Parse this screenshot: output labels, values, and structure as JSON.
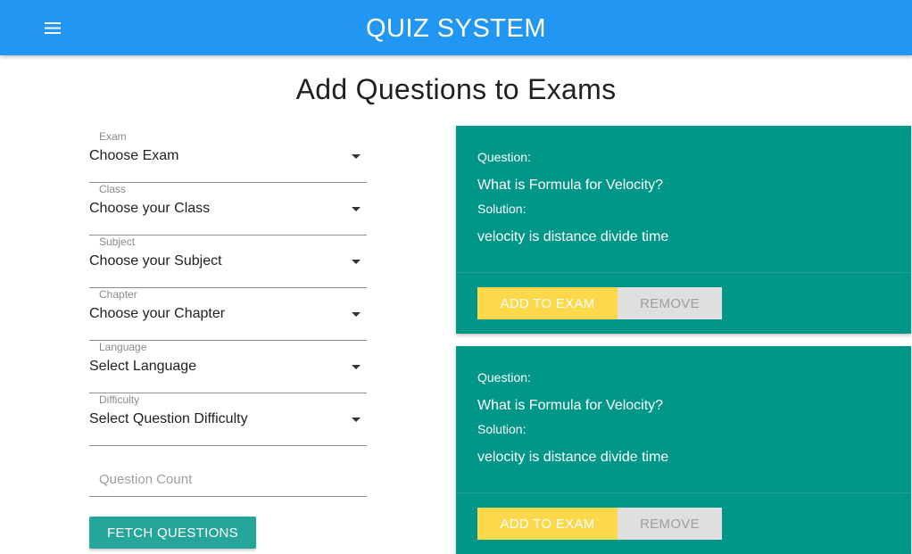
{
  "header": {
    "title": "QUIZ SYSTEM",
    "menu_icon": "hamburger-menu-icon",
    "bg_color": "#2196f3"
  },
  "page_title": "Add Questions to Exams",
  "filters": [
    {
      "label": "Exam",
      "value": "Choose Exam"
    },
    {
      "label": "Class",
      "value": "Choose your Class"
    },
    {
      "label": "Subject",
      "value": "Choose your Subject"
    },
    {
      "label": "Chapter",
      "value": "Choose your Chapter"
    },
    {
      "label": "Language",
      "value": "Select Language"
    },
    {
      "label": "Difficulty",
      "value": "Select Question Difficulty"
    }
  ],
  "question_count": {
    "placeholder": "Question Count",
    "value": ""
  },
  "fetch_button": "FETCH QUESTIONS",
  "questions": [
    {
      "question_label": "Question:",
      "question": "What is Formula for Velocity?",
      "solution_label": "Solution:",
      "solution": "velocity is distance divide time",
      "add_label": "ADD TO EXAM",
      "remove_label": "REMOVE"
    },
    {
      "question_label": "Question:",
      "question": "What is Formula for Velocity?",
      "solution_label": "Solution:",
      "solution": "velocity is distance divide time",
      "add_label": "ADD TO EXAM",
      "remove_label": "REMOVE"
    }
  ],
  "colors": {
    "card": "#009688",
    "add_button": "#fdd84a",
    "remove_button": "#dfdfdf",
    "fetch_button": "#26a69a"
  }
}
